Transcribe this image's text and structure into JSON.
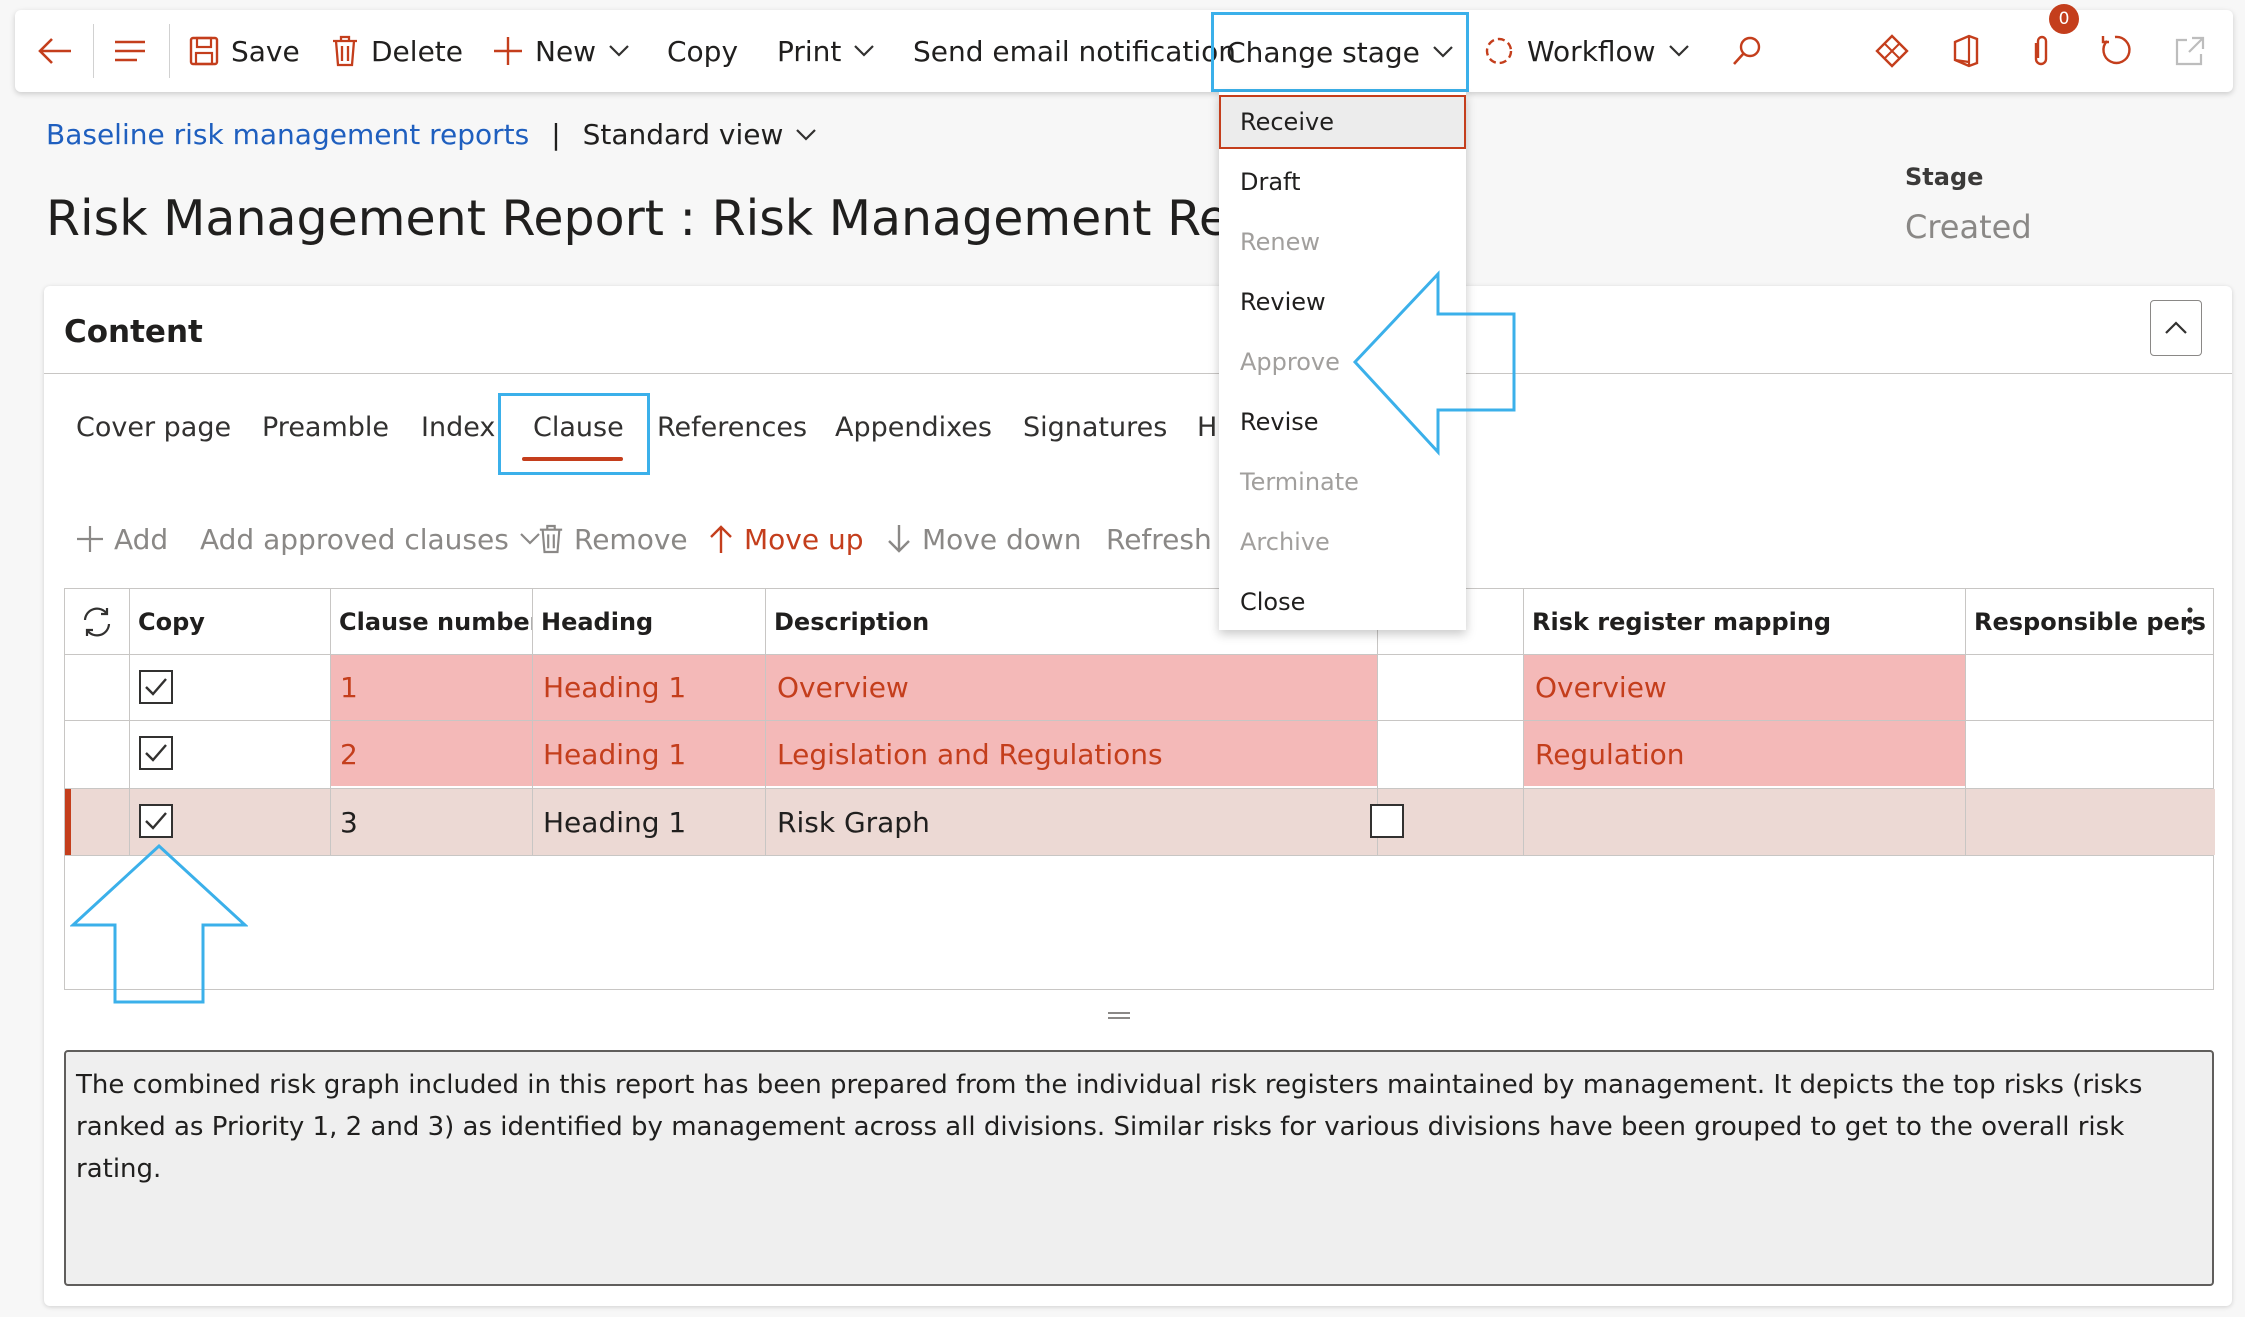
{
  "toolbar": {
    "save": "Save",
    "delete": "Delete",
    "new": "New",
    "copy": "Copy",
    "print": "Print",
    "send_email": "Send email notification",
    "change_stage": "Change stage",
    "workflow": "Workflow",
    "attachments_count": "0"
  },
  "breadcrumb": {
    "link": "Baseline risk management reports",
    "separator": "|",
    "view": "Standard view"
  },
  "page_title": "Risk Management Report : Risk Management Report",
  "stage": {
    "label": "Stage",
    "value": "Created"
  },
  "content": {
    "title": "Content",
    "tabs": [
      "Cover page",
      "Preamble",
      "Index",
      "Clause",
      "References",
      "Appendixes",
      "Signatures",
      "H"
    ],
    "active_tab": "Clause",
    "actions": {
      "add": "Add",
      "add_approved": "Add approved clauses",
      "remove": "Remove",
      "move_up": "Move up",
      "move_down": "Move down",
      "refresh": "Refresh"
    },
    "columns": {
      "copy": "Copy",
      "clause_number": "Clause number",
      "heading": "Heading",
      "description": "Description",
      "risk_register": "Risk register mapping",
      "responsible": "Responsible person"
    },
    "rows": [
      {
        "copy": true,
        "number": "1",
        "heading": "Heading 1",
        "description": "Overview",
        "mapping": "Overview",
        "responsible": ""
      },
      {
        "copy": true,
        "number": "2",
        "heading": "Heading 1",
        "description": "Legislation and Regulations",
        "mapping": "Regulation",
        "responsible": ""
      },
      {
        "copy": true,
        "number": "3",
        "heading": "Heading 1",
        "description": "Risk Graph",
        "mapping": "",
        "responsible": ""
      }
    ],
    "clause_text": "The combined risk graph included in this report has been prepared from the individual risk registers maintained by management.  It depicts the top risks (risks ranked as Priority 1, 2 and 3) as identified by management across all divisions.  Similar risks for various divisions have been grouped to get to the overall risk rating."
  },
  "stage_menu": [
    {
      "label": "Receive",
      "enabled": true
    },
    {
      "label": "Draft",
      "enabled": true
    },
    {
      "label": "Renew",
      "enabled": false
    },
    {
      "label": "Review",
      "enabled": true
    },
    {
      "label": "Approve",
      "enabled": false
    },
    {
      "label": "Revise",
      "enabled": true
    },
    {
      "label": "Terminate",
      "enabled": false
    },
    {
      "label": "Archive",
      "enabled": false
    },
    {
      "label": "Close",
      "enabled": true
    }
  ],
  "colors": {
    "accent": "#c43e1c",
    "callout": "#3bb0ea",
    "link": "#1f5fbf",
    "row_highlight": "#f4b9b8",
    "row_selected": "#ecd9d4"
  }
}
